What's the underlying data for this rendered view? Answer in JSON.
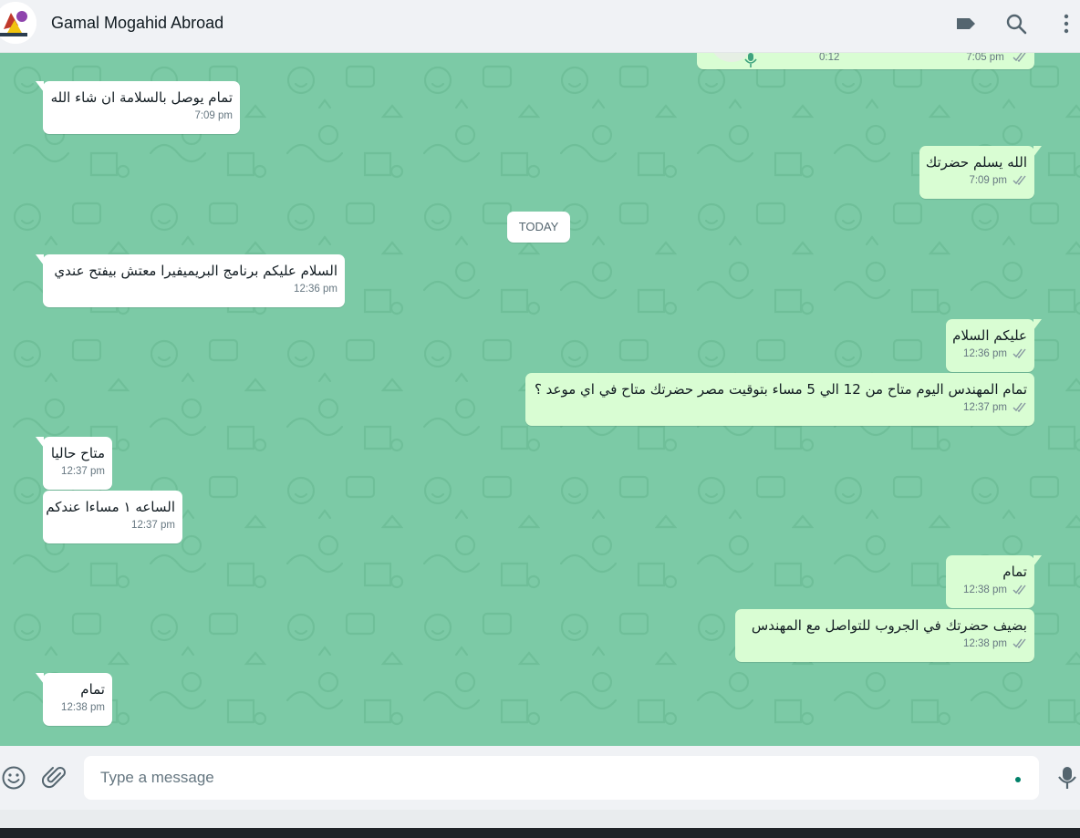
{
  "header": {
    "contact_name": "Gamal Mogahid Abroad",
    "icons": [
      "label-icon",
      "search-icon",
      "more-options-icon"
    ]
  },
  "voice_message": {
    "duration": "0:12",
    "time": "7:05 pm"
  },
  "date_divider": "TODAY",
  "messages": [
    {
      "dir": "in",
      "text": "تمام يوصل بالسلامة ان شاء الله",
      "time": "7:09 pm"
    },
    {
      "dir": "out",
      "text": "الله يسلم حضرتك",
      "time": "7:09 pm"
    },
    {
      "dir": "in",
      "text": "السلام عليكم برنامج البريميفيرا معتش بيفتح عندي",
      "time": "12:36 pm"
    },
    {
      "dir": "out",
      "text": "عليكم السلام",
      "time": "12:36 pm"
    },
    {
      "dir": "out",
      "text": "تمام المهندس اليوم متاح من 12 الي 5 مساء بتوقيت مصر حضرتك متاح في اي موعد ؟",
      "time": "12:37 pm"
    },
    {
      "dir": "in",
      "text": "متاح حاليا",
      "time": "12:37 pm"
    },
    {
      "dir": "in",
      "text": "الساعه ١ مساءا عندكم",
      "time": "12:37 pm"
    },
    {
      "dir": "out",
      "text": "تمام",
      "time": "12:38 pm"
    },
    {
      "dir": "out",
      "text": "بضيف حضرتك في الجروب للتواصل مع المهندس",
      "time": "12:38 pm"
    },
    {
      "dir": "in",
      "text": "تمام",
      "time": "12:38 pm"
    }
  ],
  "composer": {
    "placeholder": "Type a message",
    "icons": [
      "emoji-icon",
      "attach-icon",
      "microphone-icon"
    ]
  },
  "colors": {
    "wallpaper": "#7ccaa6",
    "incoming_bubble": "#ffffff",
    "outgoing_bubble": "#d9fdd3",
    "header_bg": "#f0f2f5",
    "read_ticks": "#8696a0"
  }
}
